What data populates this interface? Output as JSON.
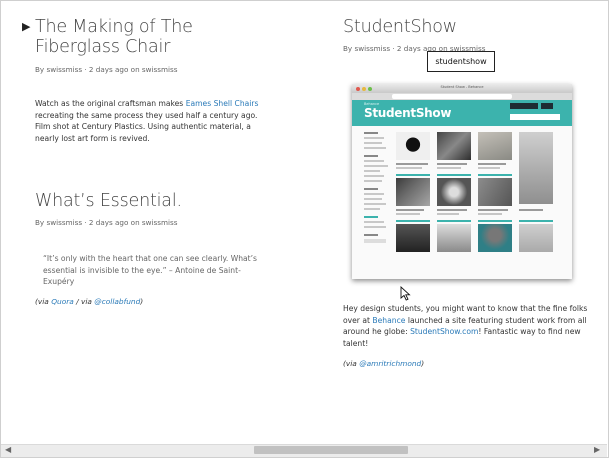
{
  "posts": [
    {
      "title": "The Making of The Fiberglass Chair",
      "meta": "By swissmiss · 2 days ago on swissmiss",
      "body_prefix": "Watch as the original craftsman makes ",
      "body_link": "Eames Shell Chairs",
      "body_suffix": " recreating the same process they used half a century ago. Film shot at Century Plastics. Using authentic material, a nearly lost art form is revived."
    },
    {
      "title": "What’s Essential.",
      "meta": "By swissmiss · 2 days ago on swissmiss",
      "quote": "“It’s only with the heart that one can see clearly. What’s essential is invisible to the eye.” – Antoine de Saint-Exupéry",
      "via_open": "(via ",
      "via_link1": "Quora",
      "via_sep": " / via ",
      "via_link2": "@collabfund",
      "via_close": ")"
    },
    {
      "title": "StudentShow",
      "meta": "By swissmiss · 2 days ago on swissmiss",
      "tooltip": "studentshow",
      "screenshot": {
        "window_title": "Student Show - Behance",
        "brand_small": "Behance",
        "brand": "StudentShow"
      },
      "body_1": "Hey design students, you might want to know that the fine folks over at ",
      "body_link1": "Behance",
      "body_2": " launched a site featuring student work from all around he globe: ",
      "body_link2": "StudentShow.com",
      "body_3": "! Fantastic way to find new talent!",
      "via_open": "(via ",
      "via_link": "@amritrichmond",
      "via_close": ")"
    }
  ],
  "scrollbar": {
    "left_arrow": "◀",
    "right_arrow": "▶"
  },
  "icons": {
    "marker": "triangle-right-icon",
    "cursor": "mouse-pointer-icon"
  },
  "colors": {
    "link": "#2a7ab8",
    "studentshow_teal": "#3cb3ad"
  }
}
